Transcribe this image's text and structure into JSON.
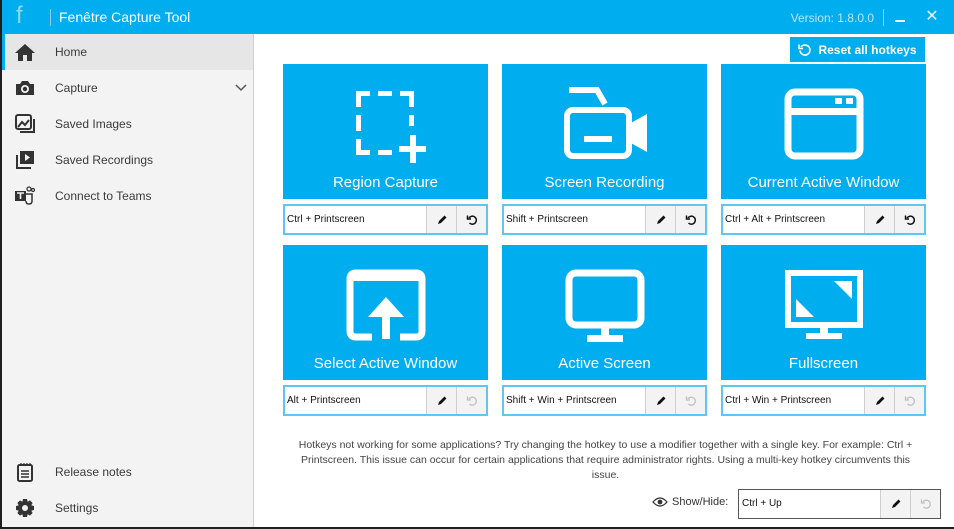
{
  "app": {
    "logo": "f",
    "title": "Fenêtre Capture Tool",
    "version": "Version: 1.8.0.0",
    "close_glyph": "✕"
  },
  "sidebar": {
    "items": [
      {
        "label": "Home",
        "icon": "home-icon",
        "active": true
      },
      {
        "label": "Capture",
        "icon": "camera-icon",
        "expandable": true
      },
      {
        "label": "Saved Images",
        "icon": "images-icon"
      },
      {
        "label": "Saved Recordings",
        "icon": "recordings-icon"
      },
      {
        "label": "Connect to Teams",
        "icon": "teams-icon"
      }
    ],
    "bottom_items": [
      {
        "label": "Release notes",
        "icon": "notepad-icon"
      },
      {
        "label": "Settings",
        "icon": "gear-icon"
      }
    ]
  },
  "main": {
    "reset_all_label": "Reset all hotkeys",
    "tiles": [
      {
        "label": "Region Capture",
        "icon": "region-capture-icon",
        "hotkey": "Ctrl + Printscreen",
        "reset_enabled": true
      },
      {
        "label": "Screen Recording",
        "icon": "video-camera-icon",
        "hotkey": "Shift + Printscreen",
        "reset_enabled": true
      },
      {
        "label": "Current Active Window",
        "icon": "window-icon",
        "hotkey": "Ctrl + Alt + Printscreen",
        "reset_enabled": true
      },
      {
        "label": "Select Active Window",
        "icon": "select-window-icon",
        "hotkey": "Alt + Printscreen",
        "reset_enabled": false
      },
      {
        "label": "Active Screen",
        "icon": "monitor-icon",
        "hotkey": "Shift + Win + Printscreen",
        "reset_enabled": false
      },
      {
        "label": "Fullscreen",
        "icon": "fullscreen-monitor-icon",
        "hotkey": "Ctrl + Win + Printscreen",
        "reset_enabled": false
      }
    ],
    "note": "Hotkeys not working for some applications? Try changing the hotkey to use a modifier together with a single key. For example: Ctrl + Printscreen. This issue can occur for certain applications that require administrator rights. Using a multi-key hotkey circumvents this issue.",
    "show_hide": {
      "label": "Show/Hide:",
      "hotkey": "Ctrl + Up",
      "reset_enabled": false
    }
  },
  "colors": {
    "accent": "#00adef",
    "sidebar_bg": "#f3f3f3",
    "active_item_bg": "#e6e6e6"
  }
}
